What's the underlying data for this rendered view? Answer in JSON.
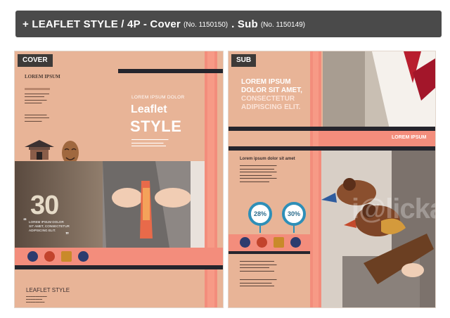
{
  "header": {
    "part1": "+ LEAFLET STYLE / 4P - Cover",
    "no1": "(No. 1150150)",
    "part2": ". Sub",
    "no2": "(No. 1150149)"
  },
  "cover": {
    "tag": "COVER",
    "lorem_title": "LOREM IPSUM",
    "lorem_dolor": "LOREM IPSUM DOLOR",
    "leaflet": "Leaflet",
    "style": "STYLE",
    "big_number": "30",
    "lorem_copy_1": "LOREM IPSUM DOLOR",
    "lorem_copy_2": "SIT AMET, CONSECTETUR",
    "lorem_copy_3": "ADIPISCING ELIT.",
    "footer_title": "LEAFLET STYLE",
    "colors": {
      "peach": "#e8b497",
      "coral": "#f38d7c",
      "dark": "#25252d"
    }
  },
  "sub": {
    "tag": "SUB",
    "headline_1": "LOREM IPSUM",
    "headline_2": "DOLOR SIT AMET,",
    "headline_3": "CONSECTETUR",
    "headline_4": "ADIPISCING ELIT.",
    "right_label": "LOREM IPSUM",
    "body_title": "Lorem ipsum dolor sit amet",
    "pct1": "28%",
    "pct2": "30%"
  },
  "watermark": "i@lickart"
}
